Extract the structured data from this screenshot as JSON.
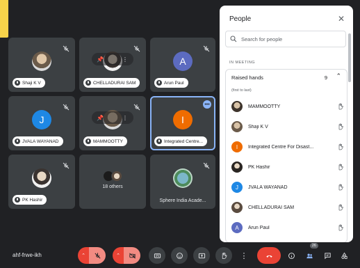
{
  "meeting": {
    "code": "ahf-frwe-ikh"
  },
  "tiles": [
    {
      "name": "Shaji K V",
      "kind": "photo"
    },
    {
      "name": "CHELLADURAI SAM",
      "kind": "photo2"
    },
    {
      "name": "Arun Paul",
      "kind": "letter",
      "letter": "A",
      "color": "#5c6bc0"
    },
    {
      "name": "JVALA WAYANAD",
      "kind": "letter",
      "letter": "J",
      "color": "#1e88e5"
    },
    {
      "name": "MAMMOOTTY",
      "kind": "photo"
    },
    {
      "name": "Integrated Centre...",
      "kind": "letter",
      "letter": "I",
      "color": "#ef6c00"
    },
    {
      "name": "PK Hashir",
      "kind": "photo2"
    },
    {
      "name": "18 others",
      "kind": "others"
    },
    {
      "name": "Sphere India Acade...",
      "kind": "globe"
    }
  ],
  "panel": {
    "title": "People",
    "search_placeholder": "Search for people",
    "section_label": "IN MEETING",
    "raised_hands_label": "Raised hands",
    "raised_hands_count": "9",
    "raised_order": "(first to last)",
    "people": [
      {
        "name": "MAMMOOTTY",
        "avatar": "photo"
      },
      {
        "name": "Shaji K V",
        "avatar": "photo"
      },
      {
        "name": "Integrated Centre For Disast...",
        "avatar": "letter",
        "letter": "I",
        "color": "#ef6c00"
      },
      {
        "name": "PK Hashir",
        "avatar": "photo2"
      },
      {
        "name": "JVALA WAYANAD",
        "avatar": "letter",
        "letter": "J",
        "color": "#1e88e5"
      },
      {
        "name": "CHELLADURAI SAM",
        "avatar": "photo2"
      },
      {
        "name": "Arun Paul",
        "avatar": "letter",
        "letter": "A",
        "color": "#5c6bc0"
      }
    ]
  },
  "toolbar": {
    "people_count": "26"
  },
  "colors": {
    "accent": "#8ab4f8",
    "end_call": "#ea4335",
    "tile_bg": "#3c4043",
    "page_bg": "#202124"
  }
}
